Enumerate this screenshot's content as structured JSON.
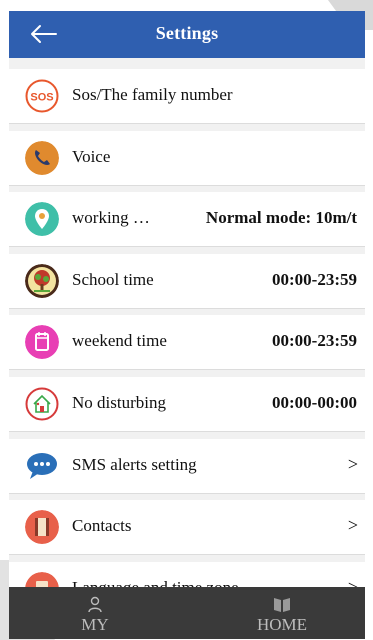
{
  "header": {
    "title": "Settings",
    "back_icon": "back-arrow-icon"
  },
  "rows": [
    {
      "icon": "sos-icon",
      "label": "Sos/The family number",
      "value": "",
      "chevron": ""
    },
    {
      "icon": "phone-icon",
      "label": "Voice",
      "value": "",
      "chevron": ""
    },
    {
      "icon": "location-pin-icon",
      "label": "working …",
      "value": "Normal mode: 10m/t",
      "chevron": ""
    },
    {
      "icon": "tree-icon",
      "label": "School time",
      "value": "00:00-23:59",
      "chevron": ""
    },
    {
      "icon": "calendar-icon",
      "label": "weekend time",
      "value": "00:00-23:59",
      "chevron": ""
    },
    {
      "icon": "house-icon",
      "label": "No disturbing",
      "value": "00:00-00:00",
      "chevron": ""
    },
    {
      "icon": "chat-bubble-icon",
      "label": "SMS alerts setting",
      "value": "",
      "chevron": ">"
    },
    {
      "icon": "contacts-book-icon",
      "label": "Contacts",
      "value": "",
      "chevron": ">"
    },
    {
      "icon": "globe-icon",
      "label": "Language and time zone",
      "value": "",
      "chevron": ">"
    }
  ],
  "tabbar": {
    "my": {
      "label": "MY",
      "icon": "person-icon"
    },
    "home": {
      "label": "HOME",
      "icon": "book-icon"
    }
  },
  "colors": {
    "header_bg": "#2f5fb0",
    "tabbar_bg": "#3a3a3a",
    "sos": "#e8572c",
    "phone": "#e08a2e",
    "pin": "#3fbfa8",
    "calendar": "#e83fb4",
    "house": "#d63a3a",
    "chat": "#2a6fb8",
    "contacts": "#e8604a"
  }
}
